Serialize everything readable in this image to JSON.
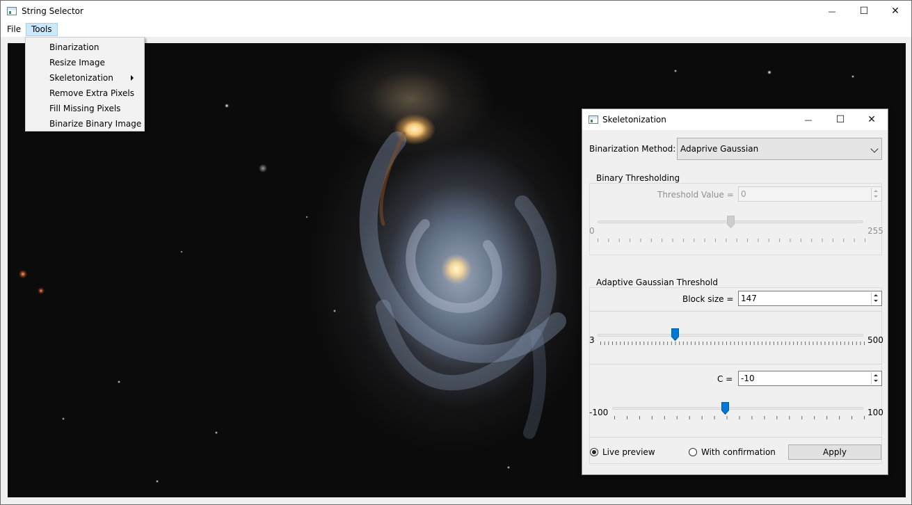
{
  "window": {
    "title": "String Selector",
    "icon": "app-window-icon",
    "caption": {
      "minimize": "—",
      "maximize": "☐",
      "close": "✕"
    }
  },
  "menubar": {
    "file": "File",
    "tools": "Tools"
  },
  "tools_menu": {
    "items": [
      {
        "label": "Binarization"
      },
      {
        "label": "Resize Image"
      },
      {
        "label": "Skeletonization",
        "submenu": true
      },
      {
        "label": "Remove Extra Pixels"
      },
      {
        "label": "Fill Missing Pixels"
      },
      {
        "label": "Binarize Binary Image"
      }
    ]
  },
  "canvas": {
    "description_icon": "galaxy-image"
  },
  "dialog": {
    "title": "Skeletonization",
    "caption": {
      "minimize": "—",
      "maximize": "☐",
      "close": "✕"
    },
    "method_label": "Binarization Method:",
    "method_value": "Adaprive Gaussian",
    "binary_group": {
      "title": "Binary Thresholding",
      "threshold_label": "Threshold Value =",
      "threshold_value": "0",
      "slider_min": "0",
      "slider_max": "255",
      "slider_fraction": 0.5
    },
    "adaptive_group": {
      "title": "Adaptive Gaussian Threshold",
      "block_label": "Block size =",
      "block_value": "147",
      "block_min": "3",
      "block_max": "500",
      "block_value_num": 147,
      "c_label": "C =",
      "c_value": "-10",
      "c_min": "-100",
      "c_max": "100",
      "c_value_num": -10
    },
    "live_preview": "Live preview",
    "with_confirmation": "With confirmation",
    "apply": "Apply",
    "accent_color": "#0078d7"
  }
}
